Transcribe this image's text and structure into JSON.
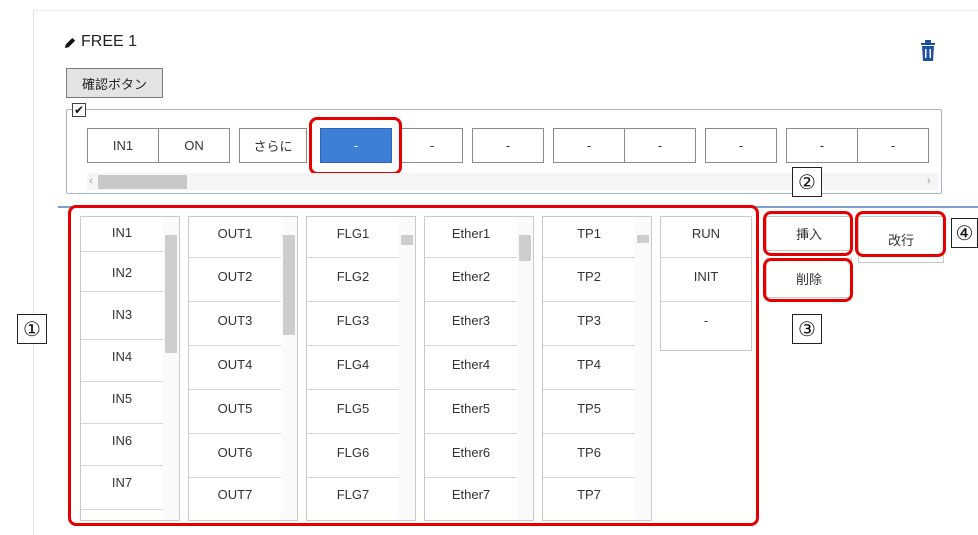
{
  "panel": {
    "title": "FREE 1",
    "confirm_label": "確認ボタン",
    "checkbox_mark": "✔"
  },
  "top_row": [
    "IN1",
    "ON",
    "さらに",
    "-",
    "-",
    "-",
    "-",
    "-",
    "-",
    "-",
    "-"
  ],
  "scroll": {
    "left_arrow": "‹",
    "right_arrow": "›"
  },
  "lists": {
    "in": [
      "IN1",
      "IN2",
      "IN3",
      "IN4",
      "IN5",
      "IN6",
      "IN7"
    ],
    "out": [
      "OUT1",
      "OUT2",
      "OUT3",
      "OUT4",
      "OUT5",
      "OUT6",
      "OUT7"
    ],
    "flg": [
      "FLG1",
      "FLG2",
      "FLG3",
      "FLG4",
      "FLG5",
      "FLG6",
      "FLG7"
    ],
    "ether": [
      "Ether1",
      "Ether2",
      "Ether3",
      "Ether4",
      "Ether5",
      "Ether6",
      "Ether7"
    ],
    "tp": [
      "TP1",
      "TP2",
      "TP3",
      "TP4",
      "TP5",
      "TP6",
      "TP7"
    ],
    "run": [
      "RUN",
      "INIT",
      "-"
    ]
  },
  "actions": {
    "insert": "挿入",
    "newline": "改行",
    "delete": "削除"
  },
  "callouts": {
    "c1": "①",
    "c2": "②",
    "c3": "③",
    "c4": "④"
  },
  "colors": {
    "annotation_red": "#e60000",
    "selected_blue": "#3d7fd6",
    "panel_border": "#9fb4d6"
  }
}
